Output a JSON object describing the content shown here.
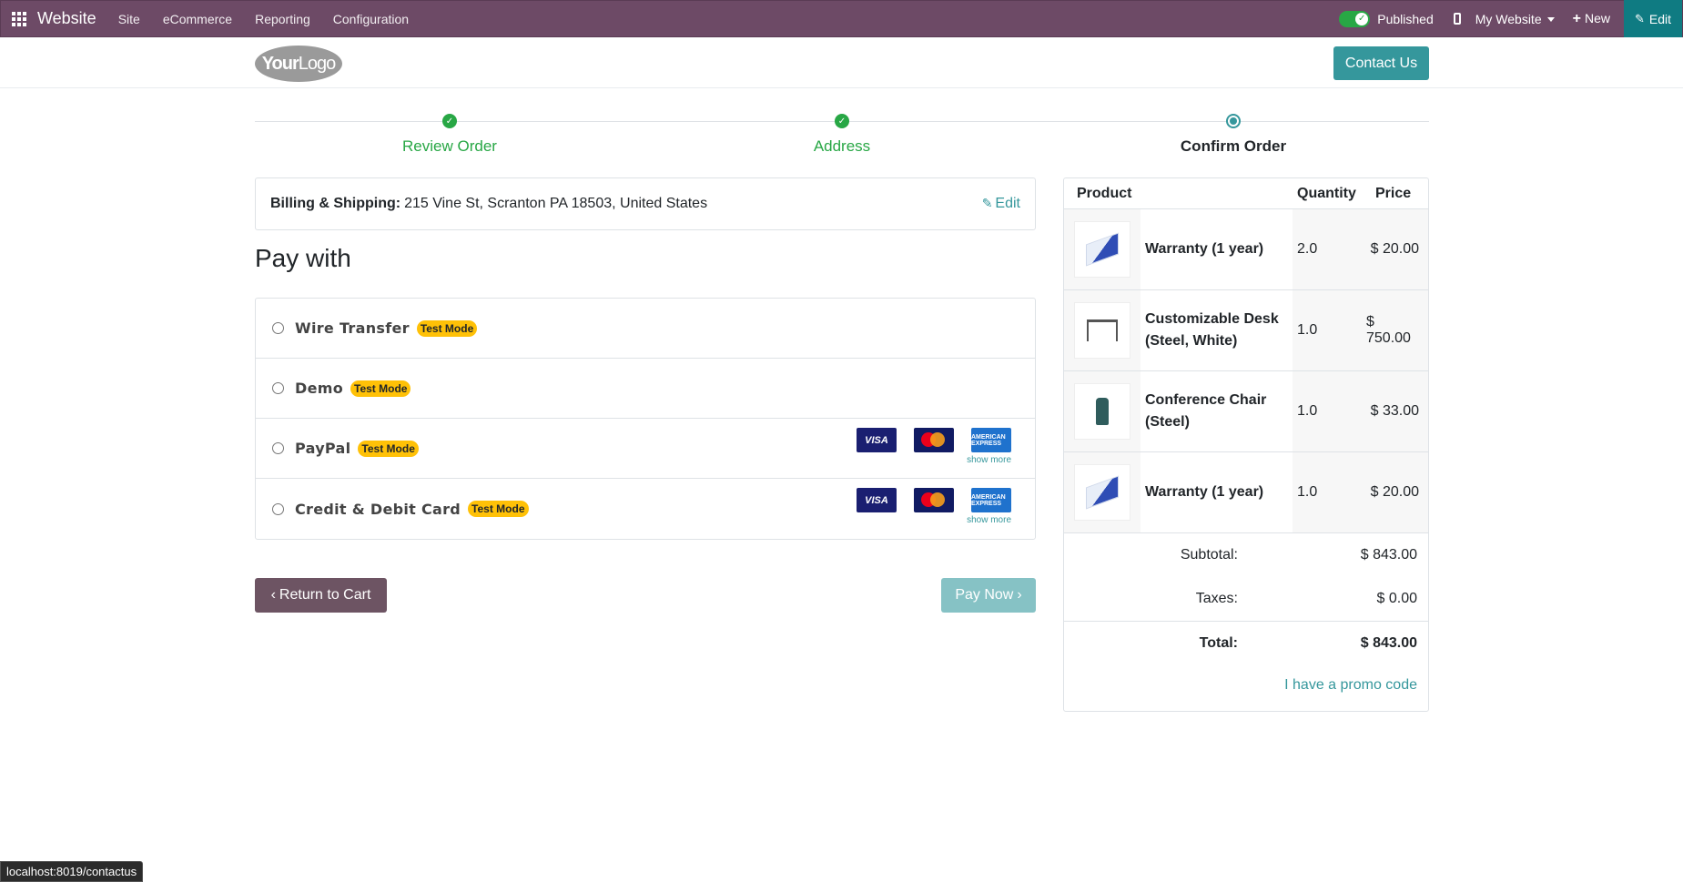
{
  "topbar": {
    "brand": "Website",
    "menu": [
      "Site",
      "eCommerce",
      "Reporting",
      "Configuration"
    ],
    "published_label": "Published",
    "website_select": "My Website",
    "new_label": "New",
    "edit_label": "Edit"
  },
  "header": {
    "logo_text_bold": "Your",
    "logo_text_light": "Logo",
    "contact_label": "Contact Us"
  },
  "wizard": {
    "steps": [
      {
        "label": "Review Order",
        "state": "done"
      },
      {
        "label": "Address",
        "state": "done"
      },
      {
        "label": "Confirm Order",
        "state": "current"
      }
    ]
  },
  "billing": {
    "label": "Billing & Shipping:",
    "address": "215 Vine St, Scranton PA 18503, United States",
    "edit_label": "Edit"
  },
  "payment": {
    "title": "Pay with",
    "methods": [
      {
        "name": "Wire Transfer",
        "badge": "Test Mode"
      },
      {
        "name": "Demo",
        "badge": "Test Mode"
      },
      {
        "name": "PayPal",
        "badge": "Test Mode",
        "card_labels": [
          "VISA",
          "",
          "AMERICAN EXPRESS"
        ],
        "show_more": "show more"
      },
      {
        "name": "Credit & Debit Card",
        "badge": "Test Mode",
        "card_labels": [
          "VISA",
          "",
          "AMERICAN EXPRESS"
        ],
        "show_more": "show more"
      }
    ],
    "return_label": "Return to Cart",
    "pay_label": "Pay Now"
  },
  "summary": {
    "headers": {
      "product": "Product",
      "quantity": "Quantity",
      "price": "Price"
    },
    "lines": [
      {
        "name": "Warranty (1 year)",
        "qty": "2.0",
        "price": "$ 20.00",
        "icon": "box-icon"
      },
      {
        "name": "Customizable Desk (Steel, White)",
        "qty": "1.0",
        "price": "$ 750.00",
        "icon": "desk-icon"
      },
      {
        "name": "Conference Chair (Steel)",
        "qty": "1.0",
        "price": "$ 33.00",
        "icon": "chair-icon"
      },
      {
        "name": "Warranty (1 year)",
        "qty": "1.0",
        "price": "$ 20.00",
        "icon": "box-icon"
      }
    ],
    "subtotal_label": "Subtotal:",
    "subtotal": "$ 843.00",
    "taxes_label": "Taxes:",
    "taxes": "$ 0.00",
    "total_label": "Total:",
    "total": "$ 843.00",
    "promo_label": "I have a promo code"
  },
  "status_url": "localhost:8019/contactus",
  "colors": {
    "topbar": "#6d4a66",
    "accent": "#35979c",
    "success": "#28a745",
    "badge": "#ffc107"
  }
}
